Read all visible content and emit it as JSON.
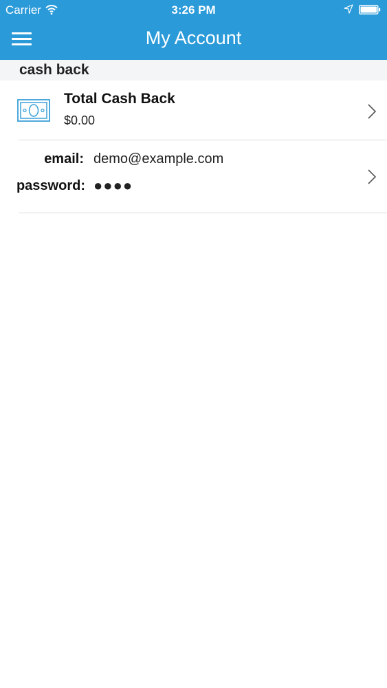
{
  "status_bar": {
    "carrier": "Carrier",
    "time": "3:26 PM",
    "icons": [
      "wifi-icon",
      "location-icon",
      "battery-icon"
    ]
  },
  "nav_bar": {
    "title": "My Account",
    "left_icon": "menu-icon"
  },
  "section": {
    "title": "cash back"
  },
  "cashback_row": {
    "icon": "cash-icon",
    "title": "Total Cash Back",
    "value": "$0.00"
  },
  "account_row": {
    "email_label": "email:",
    "email_value": "demo@example.com",
    "password_label": "password:",
    "password_value": "●●●●"
  },
  "colors": {
    "header_blue": "#2a9ad9",
    "icon_blue": "#3aa0d8",
    "section_bg": "#f4f5f7",
    "separator": "#dcdcdc"
  }
}
